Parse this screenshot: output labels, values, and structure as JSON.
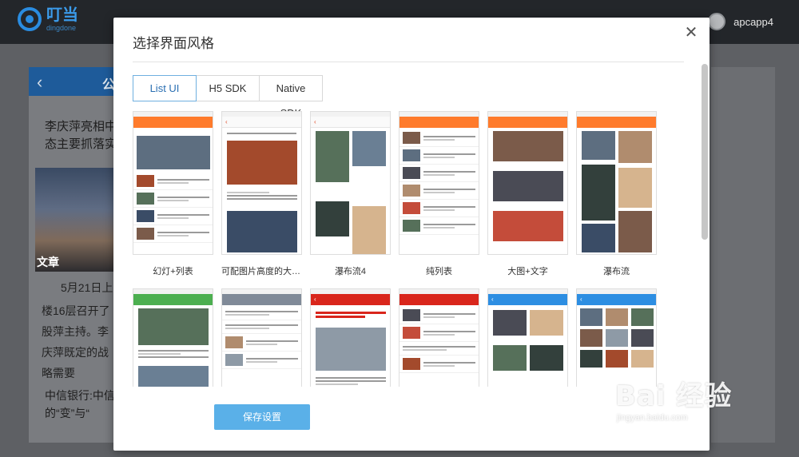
{
  "app": {
    "logo_cn": "叮当",
    "logo_en": "dingdone",
    "username": "apcapp4"
  },
  "background": {
    "panel_title": "公",
    "back_glyph": "‹",
    "news1": "李庆萍亮相中态主要抓落实",
    "image_label": "文章",
    "date": "5月21日上",
    "body": "楼16层召开了股萍主持。李庆萍既定的战略需要",
    "news2": "中信银行:中信的“变”与“"
  },
  "modal": {
    "title": "选择界面风格",
    "close_glyph": "✕",
    "tabs": [
      {
        "label": "List UI",
        "active": true
      },
      {
        "label": "H5 SDK",
        "active": false
      },
      {
        "label": "Native SDK",
        "active": false
      }
    ],
    "templates": [
      {
        "label": "幻灯+列表"
      },
      {
        "label": "可配图片高度的大图+…"
      },
      {
        "label": "瀑布流4"
      },
      {
        "label": "纯列表"
      },
      {
        "label": "大图+文字"
      },
      {
        "label": "瀑布流"
      },
      {
        "label": ""
      },
      {
        "label": ""
      },
      {
        "label": ""
      },
      {
        "label": ""
      },
      {
        "label": ""
      },
      {
        "label": ""
      }
    ],
    "save_label": "保存设置"
  },
  "watermark": {
    "main": "Bai 经验",
    "sub": "jingyan.baidu.com"
  },
  "colors": {
    "accent": "#5ab0e8",
    "topbar": "#23262a",
    "orange": "#ff7b2c",
    "red": "#d9261c",
    "blue": "#2d8ee2",
    "green": "#4caf50"
  }
}
